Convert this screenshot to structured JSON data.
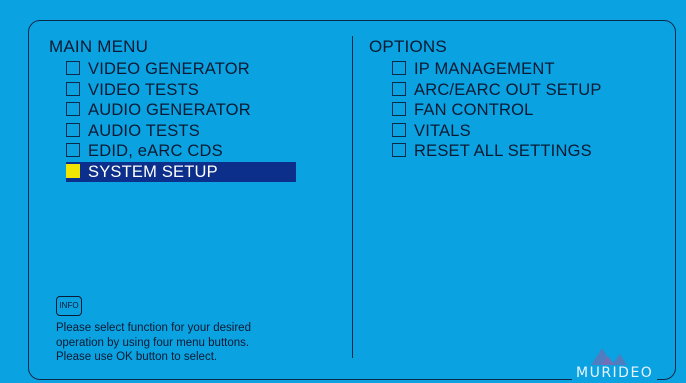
{
  "main_menu": {
    "heading": "MAIN MENU",
    "items": [
      {
        "label": "VIDEO GENERATOR",
        "selected": false
      },
      {
        "label": "VIDEO TESTS",
        "selected": false
      },
      {
        "label": "AUDIO GENERATOR",
        "selected": false
      },
      {
        "label": "AUDIO TESTS",
        "selected": false
      },
      {
        "label": "EDID, eARC CDS",
        "selected": false
      },
      {
        "label": "SYSTEM SETUP",
        "selected": true
      }
    ]
  },
  "options": {
    "heading": "OPTIONS",
    "items": [
      {
        "label": "IP MANAGEMENT"
      },
      {
        "label": "ARC/EARC OUT SETUP"
      },
      {
        "label": "FAN CONTROL"
      },
      {
        "label": "VITALS"
      },
      {
        "label": "RESET ALL SETTINGS"
      }
    ]
  },
  "info": {
    "badge": "INFO",
    "lines": [
      "Please select function for your desired",
      "operation by using four menu buttons.",
      "Please use OK button to select."
    ]
  },
  "brand": {
    "name": "MURIDEO",
    "logo_icon": "mountain-logo-icon"
  },
  "colors": {
    "background": "#0aa2e0",
    "selection": "#0b2f8a",
    "selected_checkbox": "#f2e600",
    "text": "#0a1a33"
  }
}
